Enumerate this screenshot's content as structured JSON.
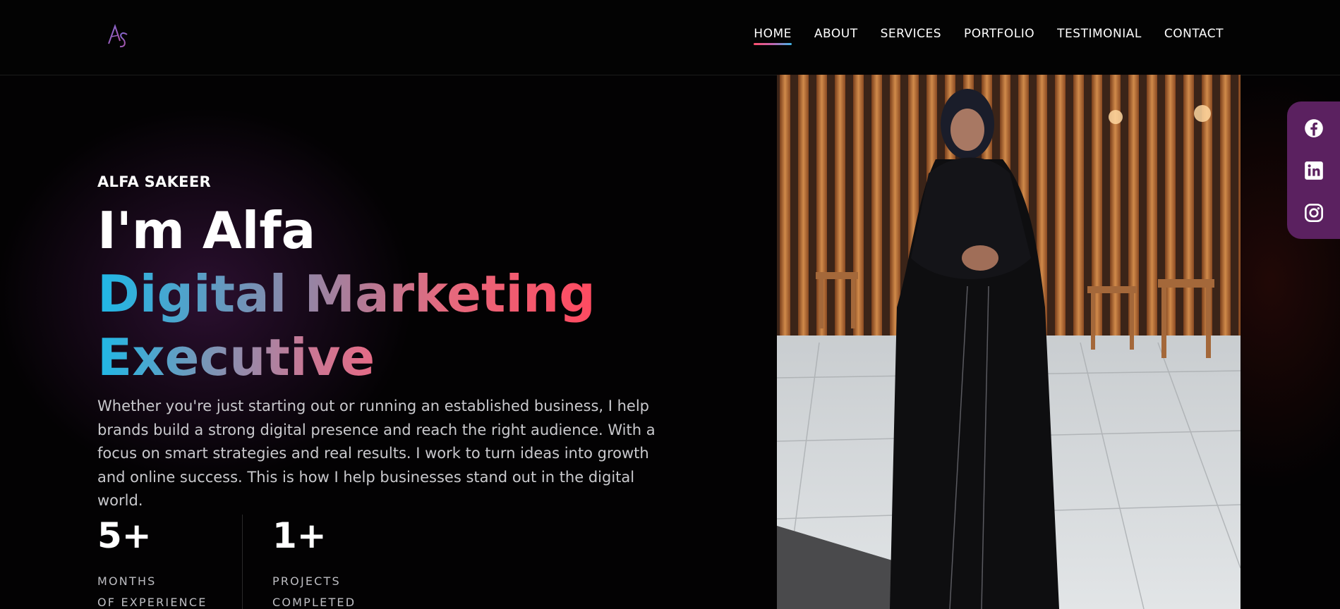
{
  "header": {
    "logo_text": "AS",
    "nav": [
      {
        "label": "HOME",
        "active": true
      },
      {
        "label": "ABOUT",
        "active": false
      },
      {
        "label": "SERVICES",
        "active": false
      },
      {
        "label": "PORTFOLIO",
        "active": false
      },
      {
        "label": "TESTIMONIAL",
        "active": false
      },
      {
        "label": "CONTACT",
        "active": false
      }
    ]
  },
  "hero": {
    "eyebrow": "ALFA SAKEER",
    "title": "I'm Alfa",
    "role_line1": "Digital Marketing",
    "role_line2": "Executive",
    "description": "Whether you're just starting out or running an established business, I help brands build a strong digital presence and reach the right audience. With a focus on smart strategies and real results. I work to turn ideas into growth and online success. This is how I help businesses stand out in the digital world.",
    "stats": [
      {
        "value": "5+",
        "label": "MONTHS\nOF EXPERIENCE"
      },
      {
        "value": "1+",
        "label": "PROJECTS\nCOMPLETED"
      }
    ]
  },
  "social": [
    {
      "icon": "facebook-icon"
    },
    {
      "icon": "linkedin-icon"
    },
    {
      "icon": "instagram-icon"
    }
  ],
  "colors": {
    "accent_blue": "#1fb8e6",
    "accent_red": "#ff4a60",
    "social_bar": "#5b2160",
    "background": "#030203"
  }
}
